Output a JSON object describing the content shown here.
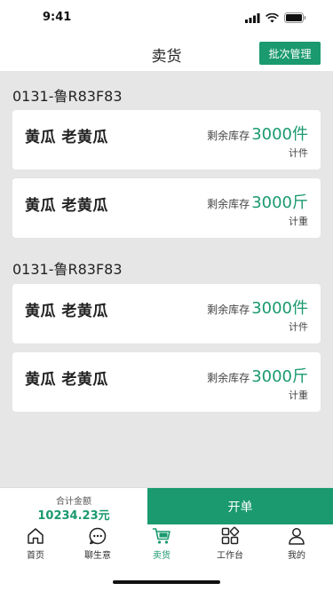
{
  "status": {
    "time": "9:41"
  },
  "nav": {
    "title": "卖货",
    "batch_label": "批次管理"
  },
  "groups": [
    {
      "title": "0131-鲁R83F83",
      "items": [
        {
          "name": "黄瓜 老黄瓜",
          "stock_label": "剩余库存",
          "stock_value": "3000件",
          "mode": "计件"
        },
        {
          "name": "黄瓜 老黄瓜",
          "stock_label": "剩余库存",
          "stock_value": "3000斤",
          "mode": "计重"
        }
      ]
    },
    {
      "title": "0131-鲁R83F83",
      "items": [
        {
          "name": "黄瓜 老黄瓜",
          "stock_label": "剩余库存",
          "stock_value": "3000件",
          "mode": "计件"
        },
        {
          "name": "黄瓜 老黄瓜",
          "stock_label": "剩余库存",
          "stock_value": "3000斤",
          "mode": "计重"
        }
      ]
    }
  ],
  "checkout": {
    "total_label": "合计金额",
    "total_value": "10234.23元",
    "open_label": "开单"
  },
  "tabs": [
    {
      "label": "首页",
      "icon": "home-icon"
    },
    {
      "label": "聊生意",
      "icon": "chat-icon"
    },
    {
      "label": "卖货",
      "icon": "cart-icon"
    },
    {
      "label": "工作台",
      "icon": "grid-icon"
    },
    {
      "label": "我的",
      "icon": "user-icon"
    }
  ],
  "colors": {
    "accent": "#1a9a6e",
    "background": "#e6e6e6"
  }
}
